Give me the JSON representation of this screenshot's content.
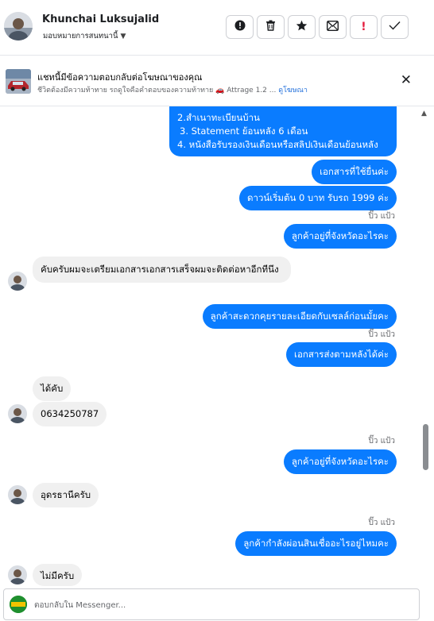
{
  "header": {
    "name": "Khunchai Luksujalid",
    "assign_label": "มอบหมายการสนทนานี้",
    "actions": [
      {
        "icon": "info-icon",
        "glyph": "⏺"
      },
      {
        "icon": "trash-icon",
        "glyph": "🗑"
      },
      {
        "icon": "star-icon",
        "glyph": "★"
      },
      {
        "icon": "mail-icon",
        "glyph": "✉"
      },
      {
        "icon": "spam-icon",
        "glyph": "!"
      },
      {
        "icon": "check-icon",
        "glyph": "✓"
      }
    ]
  },
  "ad_banner": {
    "title": "แชทนี้มีข้อความตอบกลับต่อโฆษณาของคุณ",
    "subtitle": "ชีวิตต้องมีความท้าทาย รถดูใจคือคำตอบของความท้าทาย 🚗 Attrage 1.2 ...",
    "link": "ดูโฆษณา",
    "close_glyph": "✕"
  },
  "messages": [
    {
      "dir": "out",
      "text": "2.สำเนาทะเบียนบ้าน"
    },
    {
      "dir": "out",
      "text": "3. Statement ย้อนหลัง 6 เดือน"
    },
    {
      "dir": "out",
      "text": "4. หนังสือรับรองเงินเดือนหรือสลิปเงินเดือนย้อนหลัง"
    },
    {
      "dir": "out",
      "text": "เอกสารที่ใช้ยื่นค่ะ"
    },
    {
      "dir": "out",
      "text": "ดาวน์เริ่มต้น 0 บาท รับรถ 1999 ค่ะ"
    },
    {
      "dir": "meta",
      "text": "ปิ๊ว แป้ว"
    },
    {
      "dir": "out",
      "text": "ลูกค้าอยู่ที่จังหวัดอะไรคะ"
    },
    {
      "dir": "in",
      "text": "คับครับผมจะเตรียมเอกสารเอกสารเสร็จผมจะติดต่อหาอีกทีนึง"
    },
    {
      "dir": "out",
      "text": "ลูกค้าสะดวกคุยรายละเอียดกับเซลล์ก่อนมั้ยคะ"
    },
    {
      "dir": "meta",
      "text": "ปิ๊ว แป้ว"
    },
    {
      "dir": "out",
      "text": "เอกสารส่งตามหลังได้ค่ะ"
    },
    {
      "dir": "in",
      "text": "ได้คับ"
    },
    {
      "dir": "in",
      "text": "0634250787"
    },
    {
      "dir": "meta",
      "text": "ปิ๊ว แป้ว"
    },
    {
      "dir": "out",
      "text": "ลูกค้าอยู่ที่จังหวัดอะไรคะ"
    },
    {
      "dir": "in",
      "text": "อุดรธานีครับ"
    },
    {
      "dir": "meta",
      "text": "ปิ๊ว แป้ว"
    },
    {
      "dir": "out",
      "text": "ลูกค้ากำลังผ่อนสินเชื่ออะไรอยู่ไหมคะ"
    },
    {
      "dir": "in",
      "text": "ไม่มีครับ"
    }
  ],
  "composer": {
    "placeholder": "ตอบกลับใน Messenger..."
  },
  "colors": {
    "outgoing_bubble": "#0a7cff",
    "incoming_bubble": "#f0f0f0",
    "link": "#216fdb",
    "spam_red": "#e41e3f"
  }
}
